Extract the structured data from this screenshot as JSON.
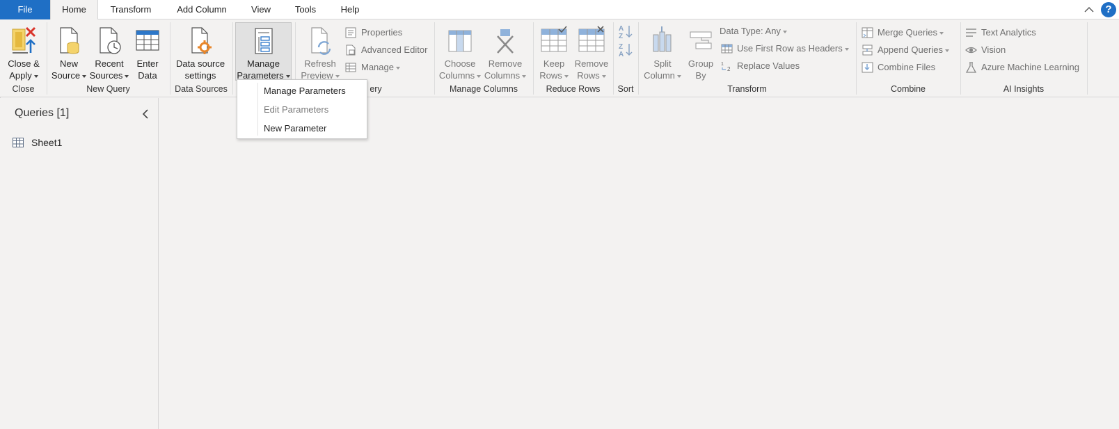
{
  "tabs": [
    "File",
    "Home",
    "Transform",
    "Add Column",
    "View",
    "Tools",
    "Help"
  ],
  "help_label": "?",
  "groups": {
    "close": "Close",
    "new_query": "New Query",
    "data_sources": "Data Sources",
    "query": "ery",
    "manage_columns": "Manage Columns",
    "reduce_rows": "Reduce Rows",
    "sort": "Sort",
    "transform": "Transform",
    "combine": "Combine",
    "ai_insights": "AI Insights"
  },
  "buttons": {
    "close_apply": [
      "Close &",
      "Apply"
    ],
    "new_source": [
      "New",
      "Source"
    ],
    "recent_sources": [
      "Recent",
      "Sources"
    ],
    "enter_data": [
      "Enter",
      "Data"
    ],
    "data_source_settings": [
      "Data source",
      "settings"
    ],
    "manage_parameters": [
      "Manage",
      "Parameters"
    ],
    "refresh_preview": [
      "Refresh",
      "Preview"
    ],
    "choose_columns": [
      "Choose",
      "Columns"
    ],
    "remove_columns": [
      "Remove",
      "Columns"
    ],
    "keep_rows": [
      "Keep",
      "Rows"
    ],
    "remove_rows": [
      "Remove",
      "Rows"
    ],
    "split_column": [
      "Split",
      "Column"
    ],
    "group_by": [
      "Group",
      "By"
    ]
  },
  "small_buttons": {
    "properties": "Properties",
    "advanced_editor": "Advanced Editor",
    "manage": "Manage",
    "data_type": "Data Type: Any",
    "use_first_row": "Use First Row as Headers",
    "replace_values": "Replace Values",
    "merge_queries": "Merge Queries",
    "append_queries": "Append Queries",
    "combine_files": "Combine Files",
    "text_analytics": "Text Analytics",
    "vision": "Vision",
    "azure_ml": "Azure Machine Learning"
  },
  "dropdown": {
    "items": [
      "Manage Parameters",
      "Edit Parameters",
      "New Parameter"
    ]
  },
  "queries": {
    "title": "Queries [1]",
    "items": [
      "Sheet1"
    ]
  },
  "colors": {
    "accent": "#1f6fc5",
    "ribbon_bg": "#f3f2f1",
    "orange": "#e8862a",
    "red": "#d9342b"
  }
}
